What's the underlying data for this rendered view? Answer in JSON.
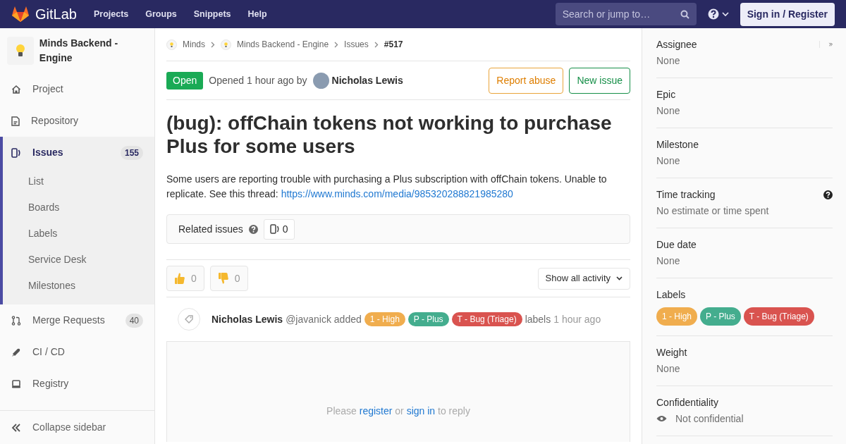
{
  "navbar": {
    "brand": "GitLab",
    "links": [
      "Projects",
      "Groups",
      "Snippets",
      "Help"
    ],
    "search": {
      "placeholder": "Search or jump to…"
    },
    "sign_in": "Sign in / Register"
  },
  "sidebar": {
    "project_name": "Minds Backend - Engine",
    "items": [
      {
        "label": "Project",
        "selected": false
      },
      {
        "label": "Repository",
        "selected": false
      },
      {
        "label": "Issues",
        "count": "155",
        "selected": true,
        "children": [
          {
            "label": "List"
          },
          {
            "label": "Boards"
          },
          {
            "label": "Labels"
          },
          {
            "label": "Service Desk"
          },
          {
            "label": "Milestones"
          }
        ]
      },
      {
        "label": "Merge Requests",
        "count": "40",
        "selected": false
      },
      {
        "label": "CI / CD",
        "selected": false
      },
      {
        "label": "Registry",
        "selected": false
      }
    ],
    "collapse": "Collapse sidebar"
  },
  "breadcrumbs": [
    {
      "label": "Minds"
    },
    {
      "label": "Minds Backend - Engine"
    },
    {
      "label": "Issues"
    },
    {
      "label": "#517"
    }
  ],
  "issue": {
    "status": "Open",
    "opened": "Opened 1 hour ago by",
    "author": "Nicholas Lewis",
    "buttons": [
      {
        "label": "Report abuse",
        "kind": "warning"
      },
      {
        "label": "New issue",
        "kind": "success"
      }
    ],
    "title": "(bug): offChain tokens not working to purchase Plus for some users",
    "description": {
      "text": "Some users are reporting trouble with purchasing a Plus subscription with offChain tokens. Unable to replicate. See this thread:",
      "link": "https://www.minds.com/media/985320288821985280"
    },
    "related": {
      "label": "Related issues",
      "count": "0"
    },
    "reactions": [
      {
        "kind": "up",
        "count": "0"
      },
      {
        "kind": "down",
        "count": "0"
      }
    ],
    "activity_filter": "Show all activity",
    "note": {
      "author": "Nicholas Lewis",
      "handle": "@javanick added",
      "suffix": "labels",
      "time": "1 hour ago",
      "labels": [
        {
          "text": "1 - High",
          "color": "#f0ad4e"
        },
        {
          "text": "P - Plus",
          "color": "#44ad8e"
        },
        {
          "text": "T - Bug (Triage)",
          "color": "#d9534f"
        }
      ]
    },
    "reply": [
      {
        "kind": "text",
        "text": "Please"
      },
      {
        "kind": "link",
        "text": "register"
      },
      {
        "kind": "text",
        "text": "or"
      },
      {
        "kind": "link",
        "text": "sign in"
      },
      {
        "kind": "text",
        "text": "to reply"
      }
    ]
  },
  "right_sidebar": {
    "blocks": [
      {
        "title": "Assignee",
        "value": "None",
        "kind": "plain"
      },
      {
        "title": "Epic",
        "value": "None",
        "kind": "plain"
      },
      {
        "title": "Milestone",
        "value": "None",
        "kind": "plain"
      },
      {
        "title": "Time tracking",
        "value": "No estimate or time spent",
        "kind": "help"
      },
      {
        "title": "Due date",
        "value": "None",
        "kind": "plain"
      },
      {
        "title": "Labels",
        "kind": "labels",
        "labels": [
          {
            "text": "1 - High",
            "color": "#f0ad4e"
          },
          {
            "text": "P - Plus",
            "color": "#44ad8e"
          },
          {
            "text": "T - Bug (Triage)",
            "color": "#d9534f"
          }
        ]
      },
      {
        "title": "Weight",
        "value": "None",
        "kind": "plain"
      },
      {
        "title": "Confidentiality",
        "value": "Not confidential",
        "kind": "eye"
      }
    ]
  }
}
